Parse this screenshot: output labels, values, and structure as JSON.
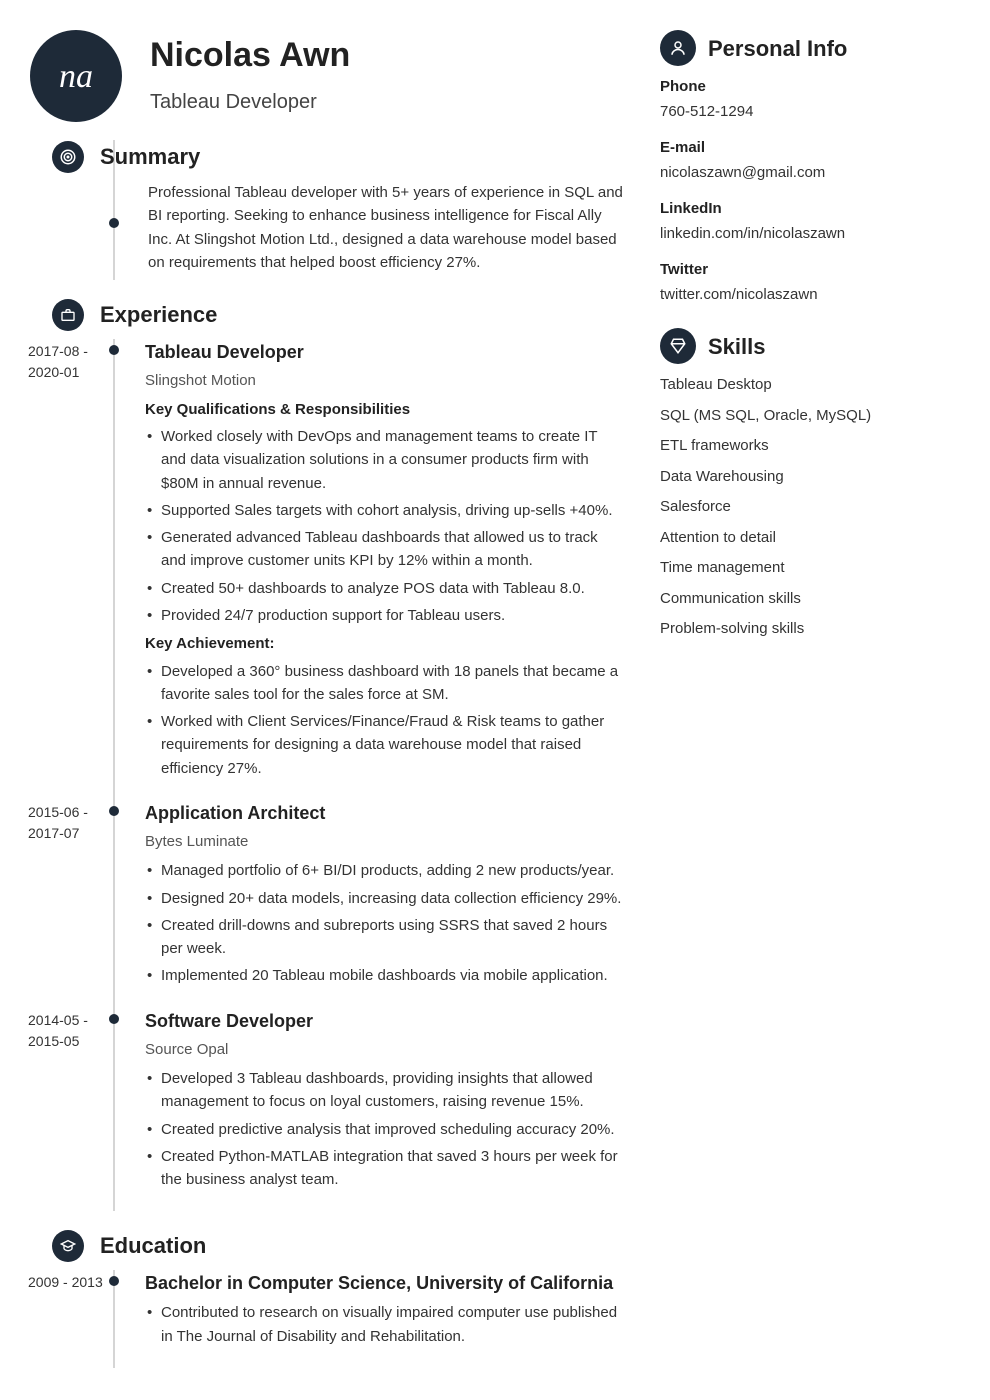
{
  "header": {
    "initials": "na",
    "name": "Nicolas Awn",
    "title": "Tableau Developer"
  },
  "sections": {
    "summary_label": "Summary",
    "experience_label": "Experience",
    "education_label": "Education"
  },
  "summary": "Professional Tableau developer with 5+ years of experience in SQL and BI reporting. Seeking to enhance business intelligence for Fiscal Ally Inc. At Slingshot Motion Ltd., designed a data warehouse model based on requirements that helped boost efficiency 27%.",
  "experience": [
    {
      "dates": "2017-08 - 2020-01",
      "title": "Tableau Developer",
      "company": "Slingshot Motion",
      "sub1": "Key Qualifications & Responsibilities",
      "bullets1": [
        "Worked closely with DevOps and management teams to create IT and data visualization solutions in a consumer products firm with $80M in annual revenue.",
        "Supported Sales targets with cohort analysis, driving up-sells +40%.",
        "Generated advanced Tableau dashboards that allowed us to track and improve customer units KPI by 12% within a month.",
        "Created 50+ dashboards to analyze POS data with Tableau 8.0.",
        "Provided 24/7 production support for Tableau users."
      ],
      "sub2": "Key Achievement:",
      "bullets2": [
        "Developed a 360° business dashboard with 18 panels that became a favorite sales tool for the sales force at SM.",
        "Worked with Client Services/Finance/Fraud & Risk teams to gather requirements for designing a data warehouse model that raised efficiency 27%."
      ]
    },
    {
      "dates": "2015-06 - 2017-07",
      "title": "Application Architect",
      "company": "Bytes Luminate",
      "bullets1": [
        "Managed portfolio of 6+ BI/DI products, adding 2 new products/year.",
        "Designed 20+ data models, increasing data collection efficiency 29%.",
        "Created drill-downs and subreports using SSRS that saved 2 hours per week.",
        "Implemented 20 Tableau mobile dashboards via mobile application."
      ]
    },
    {
      "dates": "2014-05 - 2015-05",
      "title": "Software Developer",
      "company": "Source Opal",
      "bullets1": [
        "Developed 3 Tableau dashboards, providing insights that allowed management to focus on loyal customers, raising revenue 15%.",
        "Created predictive analysis that improved scheduling accuracy 20%.",
        "Created Python-MATLAB integration that saved 3 hours per week for the business analyst team."
      ]
    }
  ],
  "education": [
    {
      "dates": "2009 - 2013",
      "title": "Bachelor in Computer Science, University of California",
      "bullets1": [
        "Contributed to research on visually impaired computer use published in The Journal of Disability and Rehabilitation."
      ]
    }
  ],
  "right": {
    "personal_label": "Personal Info",
    "skills_label": "Skills",
    "info": [
      {
        "label": "Phone",
        "value": "760-512-1294"
      },
      {
        "label": "E-mail",
        "value": "nicolaszawn@gmail.com"
      },
      {
        "label": "LinkedIn",
        "value": "linkedin.com/in/nicolaszawn"
      },
      {
        "label": "Twitter",
        "value": "twitter.com/nicolaszawn"
      }
    ],
    "skills": [
      "Tableau Desktop",
      "SQL (MS SQL, Oracle, MySQL)",
      "ETL frameworks",
      "Data Warehousing",
      "Salesforce",
      "Attention to detail",
      "Time management",
      "Communication skills",
      "Problem-solving skills"
    ]
  }
}
